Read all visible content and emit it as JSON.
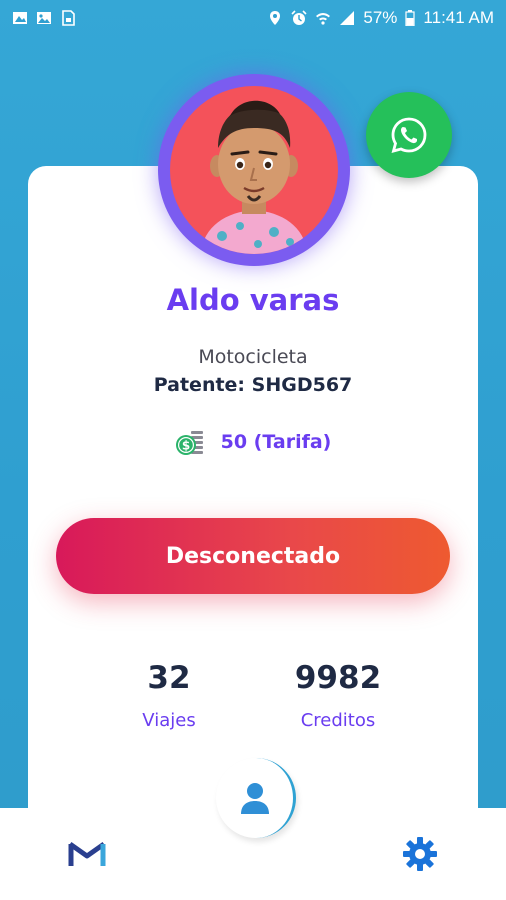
{
  "status_bar": {
    "battery_percent": "57%",
    "time": "11:41 AM",
    "left_icons": [
      "photo-icon",
      "image-icon",
      "sim-icon"
    ],
    "right_icons": [
      "location-icon",
      "alarm-icon",
      "wifi-icon",
      "signal-icon",
      "battery-icon"
    ]
  },
  "driver": {
    "name": "Aldo varas",
    "vehicle_type": "Motocicleta",
    "plate": "Patente: SHGD567",
    "fare": "50 (Tarifa)"
  },
  "status_button": {
    "label": "Desconectado"
  },
  "stats": {
    "trips_value": "32",
    "trips_label": "Viajes",
    "credits_value": "9982",
    "credits_label": "Creditos"
  },
  "bottom_nav": {
    "items": [
      "mail-icon",
      "settings-icon"
    ]
  },
  "colors": {
    "accent": "#6a3df0",
    "background": "#2f9fd0",
    "whatsapp": "#25c05a",
    "status_button_start": "#d8195a",
    "status_button_end": "#ee5a30"
  }
}
